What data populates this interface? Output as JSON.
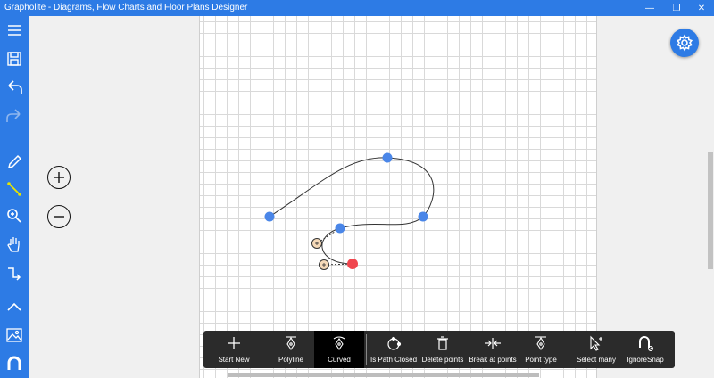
{
  "window": {
    "title": "Grapholite - Diagrams, Flow Charts and Floor Plans Designer",
    "minimize_glyph": "—",
    "maximize_glyph": "❐",
    "close_glyph": "✕"
  },
  "sidebar": {
    "items": [
      {
        "name": "menu-icon"
      },
      {
        "name": "save-icon"
      },
      {
        "name": "undo-icon"
      },
      {
        "name": "redo-icon"
      },
      {
        "name": "pencil-icon"
      },
      {
        "name": "line-tool-icon"
      },
      {
        "name": "zoom-icon"
      },
      {
        "name": "hand-pan-icon"
      },
      {
        "name": "connector-icon"
      },
      {
        "name": "collapse-up-icon"
      },
      {
        "name": "image-icon"
      },
      {
        "name": "magnet-icon"
      }
    ]
  },
  "zoom": {
    "in_glyph": "+",
    "out_glyph": "−"
  },
  "toolbar": {
    "items": [
      {
        "label": "Start New",
        "icon": "plus-icon"
      },
      {
        "label": "Polyline",
        "icon": "polyline-pen-icon"
      },
      {
        "label": "Curved",
        "icon": "curved-pen-icon",
        "active": true
      },
      {
        "label": "Is Path Closed",
        "icon": "closed-path-icon"
      },
      {
        "label": "Delete points",
        "icon": "delete-points-icon"
      },
      {
        "label": "Break at points",
        "icon": "break-points-icon"
      },
      {
        "label": "Point type",
        "icon": "point-type-icon"
      },
      {
        "label": "Select many",
        "icon": "select-many-icon"
      },
      {
        "label": "IgnoreSnap",
        "icon": "ignore-snap-icon"
      }
    ]
  },
  "colors": {
    "accent": "#2d7be5",
    "anchor_point": "#4a86e8",
    "end_point": "#f0464e",
    "handle_point": "#f5d9b8",
    "toolbar_bg": "#2b2b2b"
  }
}
